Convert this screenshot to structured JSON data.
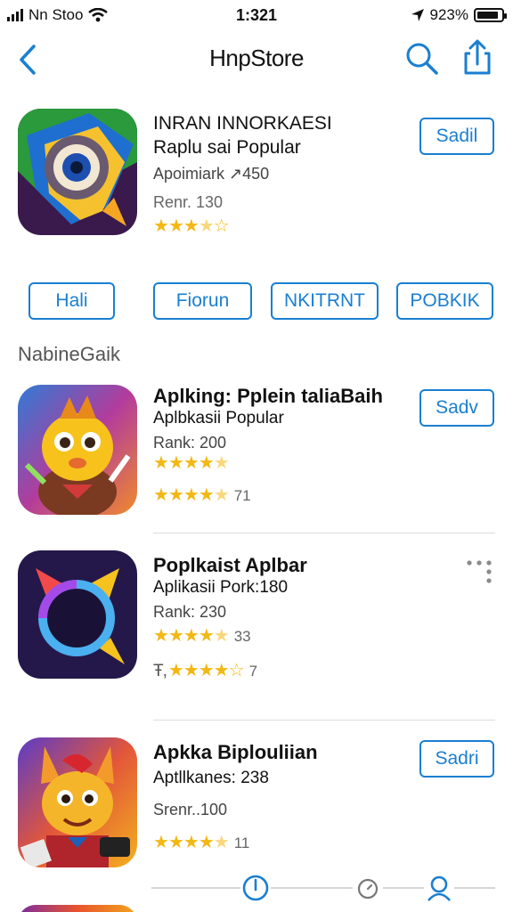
{
  "status_bar": {
    "carrier": "Nn Stoo",
    "time": "1:321",
    "battery_text": "923%",
    "battery_level": 0.9
  },
  "nav": {
    "title": "HnpStore",
    "back_icon": "chevron-left-icon",
    "search_icon": "search-icon",
    "share_icon": "share-icon"
  },
  "featured": {
    "name": "INRAN INNORKAESI",
    "subtitle": "Raplu sai Popular",
    "meta": "Apoimiark ↗450",
    "rank": "Renr. 130",
    "rating": 3.5,
    "button": "Sadil"
  },
  "categories": [
    "Hali",
    "Fiorun",
    "NKITRNT",
    "POBKIK"
  ],
  "section_label": "NabineGaik",
  "apps": [
    {
      "name": "Aplking: Pplein taliaBaih",
      "subtitle": "Aplbkasii Popular",
      "rank": "Rank: 200",
      "rating_a": 4.5,
      "rating_b": 4.5,
      "count": "71",
      "button": "Sadv"
    },
    {
      "name": "Poplkaist Aplbar",
      "subtitle": "Aplikasii Pork:180",
      "rank": "Rank: 230",
      "rating_a": 4.5,
      "count_a": "33",
      "rating_b": 4,
      "count_b": "7",
      "prefix": "Ŧ,"
    },
    {
      "name": "Apkka Biplouliian",
      "subtitle": "Aptllkanes: 238",
      "rank": "Srenr..100",
      "rating": 4.5,
      "count": "11",
      "button": "Sadri"
    }
  ],
  "tab_bar": {
    "icons": [
      "clock-icon",
      "timer-icon",
      "account-icon"
    ]
  },
  "colors": {
    "accent": "#1a7fd1",
    "star": "#f3b814"
  }
}
